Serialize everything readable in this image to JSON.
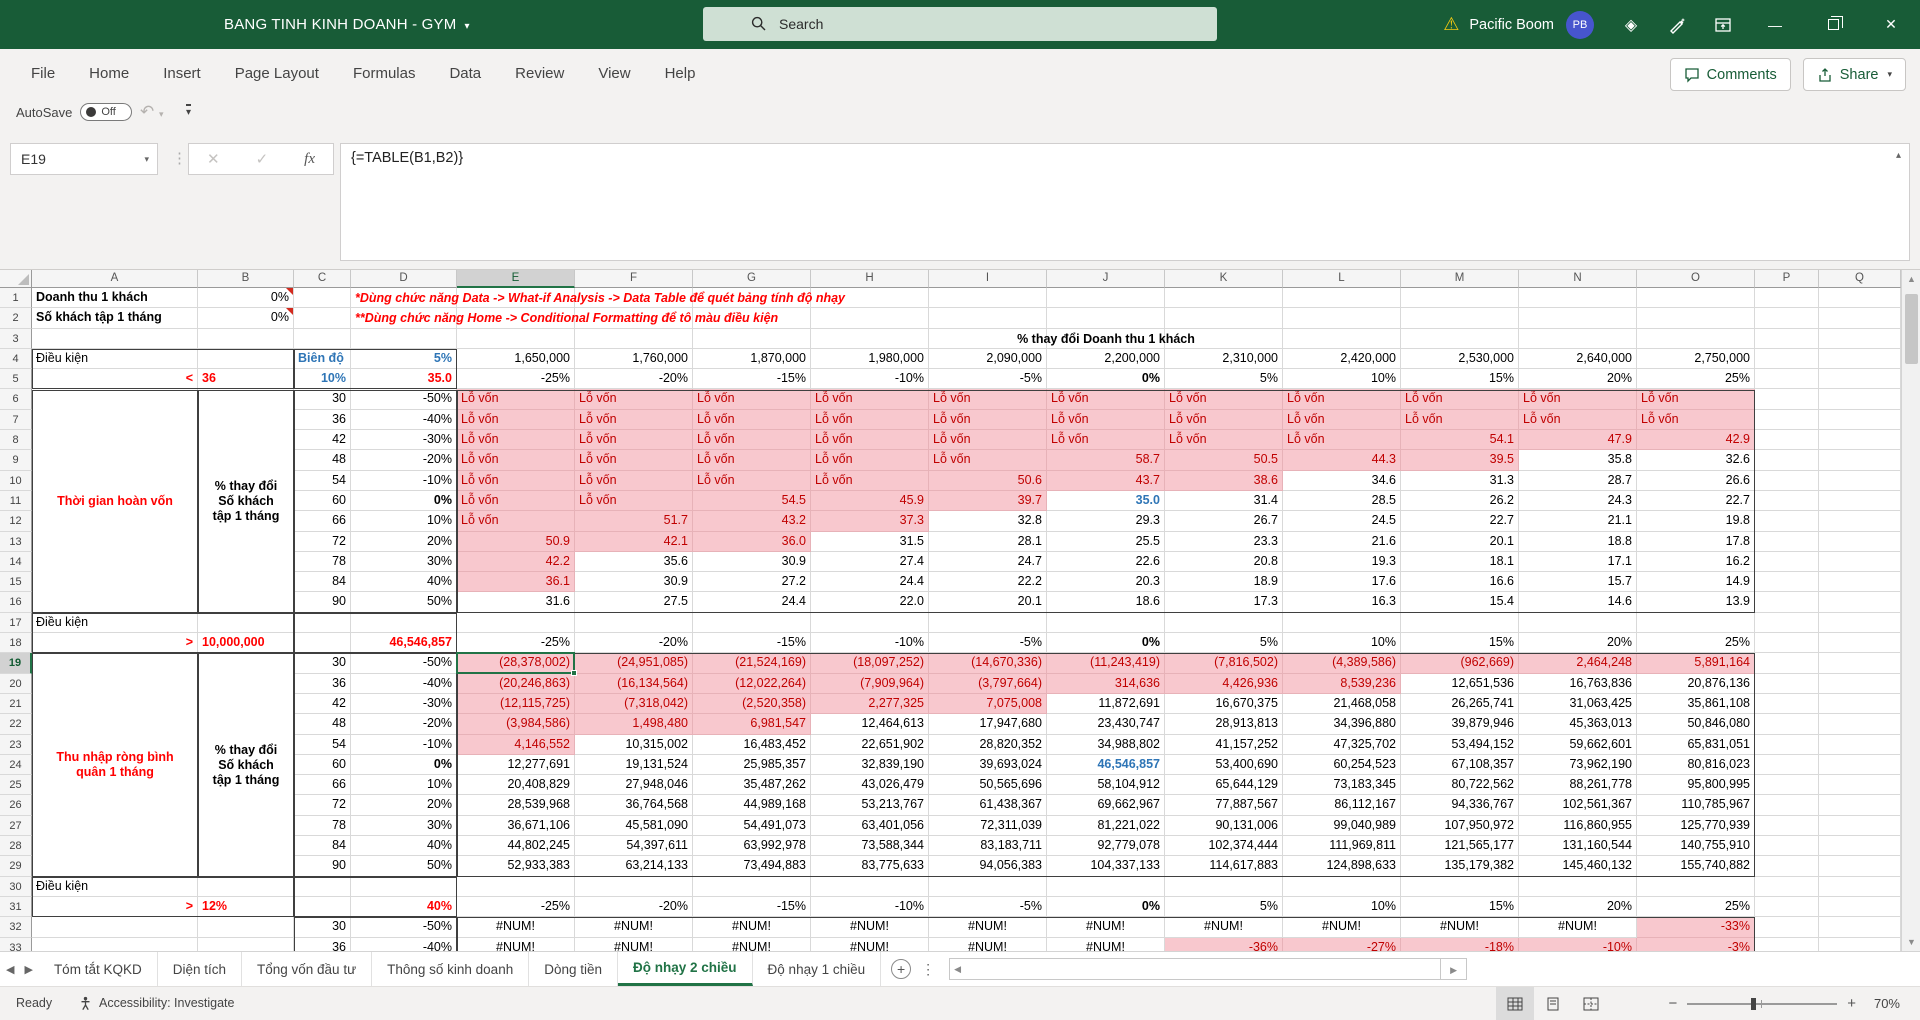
{
  "titlebar": {
    "doc_title": "BANG TINH KINH DOANH - GYM",
    "search_placeholder": "Search",
    "account_name": "Pacific Boom",
    "account_initials": "PB"
  },
  "menu": {
    "items": [
      "File",
      "Home",
      "Insert",
      "Page Layout",
      "Formulas",
      "Data",
      "Review",
      "View",
      "Help"
    ],
    "comments_label": "Comments",
    "share_label": "Share"
  },
  "qat": {
    "autosave_label": "AutoSave",
    "autosave_state": "Off"
  },
  "formula_bar": {
    "cell_ref": "E19",
    "formula": "{=TABLE(B1,B2)}"
  },
  "labels": {
    "lo_von": "Lỗ vốn",
    "num_err": "#NUM!"
  },
  "notes": {
    "note1": "*Dùng chức năng Data -> What-if Analysis -> Data Table để quét bảng tính độ nhạy",
    "note2": "**Dùng chức năng Home -> Conditional Formatting để tô màu điều kiện"
  },
  "grid": {
    "columns": [
      "A",
      "B",
      "C",
      "D",
      "E",
      "F",
      "G",
      "H",
      "I",
      "J",
      "K",
      "L",
      "M",
      "N",
      "O",
      "P",
      "Q"
    ],
    "revenue_header": "% thay đổi Doanh thu 1 khách",
    "money_cols": [
      "1,650,000",
      "1,760,000",
      "1,870,000",
      "1,980,000",
      "2,090,000",
      "2,200,000",
      "2,310,000",
      "2,420,000",
      "2,530,000",
      "2,640,000",
      "2,750,000"
    ],
    "pct_cols": [
      "-25%",
      "-20%",
      "-15%",
      "-10%",
      "-5%",
      "0%",
      "5%",
      "10%",
      "15%",
      "20%",
      "25%"
    ],
    "selection": {
      "ref": "E19",
      "col": "E",
      "row": 19
    },
    "cells_static": [
      {
        "r": 1,
        "c": "A",
        "t": "Doanh thu 1 khách",
        "cls": "b lft"
      },
      {
        "r": 1,
        "c": "B",
        "t": "0%",
        "cls": "rt cmt"
      },
      {
        "r": 2,
        "c": "A",
        "t": "Số khách tập 1 tháng",
        "cls": "b lft"
      },
      {
        "r": 2,
        "c": "B",
        "t": "0%",
        "cls": "rt cmt"
      },
      {
        "r": 4,
        "c": "A",
        "t": "Điều kiện",
        "cls": "lft"
      },
      {
        "r": 4,
        "c": "C",
        "t": "Biên độ",
        "cls": "blue lft"
      },
      {
        "r": 4,
        "c": "D",
        "t": "5%",
        "cls": "blue rt"
      },
      {
        "r": 5,
        "c": "A",
        "t": "<",
        "cls": "red2 b rt"
      },
      {
        "r": 5,
        "c": "B",
        "t": "36",
        "cls": "red2 b lft"
      },
      {
        "r": 5,
        "c": "C",
        "t": "10%",
        "cls": "blue rt"
      },
      {
        "r": 5,
        "c": "D",
        "t": "35.0",
        "cls": "red2 b rt"
      },
      {
        "r": 17,
        "c": "A",
        "t": "Điều kiện",
        "cls": "lft"
      },
      {
        "r": 18,
        "c": "A",
        "t": ">",
        "cls": "red2 b rt"
      },
      {
        "r": 18,
        "c": "B",
        "t": "10,000,000",
        "cls": "red2 b lft"
      },
      {
        "r": 18,
        "c": "D",
        "t": "46,546,857",
        "cls": "red2 b rt"
      },
      {
        "r": 30,
        "c": "A",
        "t": "Điều kiện",
        "cls": "lft"
      },
      {
        "r": 31,
        "c": "A",
        "t": ">",
        "cls": "red2 b rt"
      },
      {
        "r": 31,
        "c": "B",
        "t": "12%",
        "cls": "red2 b lft"
      },
      {
        "r": 31,
        "c": "D",
        "t": "40%",
        "cls": "red2 b rt"
      }
    ]
  },
  "table1": {
    "a_label_lines": [
      "Thời gian hoàn vốn"
    ],
    "b_label_lines": [
      "% thay đổi",
      "Số khách",
      "tập 1 tháng"
    ],
    "rows": [
      {
        "r": 6,
        "khach": "30",
        "pct": "-50%",
        "cells": [
          "L",
          "L",
          "L",
          "L",
          "L",
          "L",
          "L",
          "L",
          "L",
          "L",
          "L"
        ]
      },
      {
        "r": 7,
        "khach": "36",
        "pct": "-40%",
        "cells": [
          "L",
          "L",
          "L",
          "L",
          "L",
          "L",
          "L",
          "L",
          "L",
          "L",
          "L"
        ]
      },
      {
        "r": 8,
        "khach": "42",
        "pct": "-30%",
        "cells": [
          "L",
          "L",
          "L",
          "L",
          "L",
          "L",
          "L",
          "L",
          "p:54.1",
          "p:47.9",
          "p:42.9"
        ]
      },
      {
        "r": 9,
        "khach": "48",
        "pct": "-20%",
        "cells": [
          "L",
          "L",
          "L",
          "L",
          "L",
          "p:58.7",
          "p:50.5",
          "p:44.3",
          "p:39.5",
          "w:35.8",
          "w:32.6"
        ]
      },
      {
        "r": 10,
        "khach": "54",
        "pct": "-10%",
        "cells": [
          "L",
          "L",
          "L",
          "L",
          "p:50.6",
          "p:43.7",
          "p:38.6",
          "w:34.6",
          "w:31.3",
          "w:28.7",
          "w:26.6"
        ]
      },
      {
        "r": 11,
        "khach": "60",
        "pct": "0%",
        "cells": [
          "L",
          "L",
          "p:54.5",
          "p:45.9",
          "p:39.7",
          "b:35.0",
          "w:31.4",
          "w:28.5",
          "w:26.2",
          "w:24.3",
          "w:22.7"
        ]
      },
      {
        "r": 12,
        "khach": "66",
        "pct": "10%",
        "cells": [
          "L",
          "p:51.7",
          "p:43.2",
          "p:37.3",
          "w:32.8",
          "w:29.3",
          "w:26.7",
          "w:24.5",
          "w:22.7",
          "w:21.1",
          "w:19.8"
        ]
      },
      {
        "r": 13,
        "khach": "72",
        "pct": "20%",
        "cells": [
          "p:50.9",
          "p:42.1",
          "p:36.0",
          "w:31.5",
          "w:28.1",
          "w:25.5",
          "w:23.3",
          "w:21.6",
          "w:20.1",
          "w:18.8",
          "w:17.8"
        ]
      },
      {
        "r": 14,
        "khach": "78",
        "pct": "30%",
        "cells": [
          "p:42.2",
          "w:35.6",
          "w:30.9",
          "w:27.4",
          "w:24.7",
          "w:22.6",
          "w:20.8",
          "w:19.3",
          "w:18.1",
          "w:17.1",
          "w:16.2"
        ]
      },
      {
        "r": 15,
        "khach": "84",
        "pct": "40%",
        "cells": [
          "p:36.1",
          "w:30.9",
          "w:27.2",
          "w:24.4",
          "w:22.2",
          "w:20.3",
          "w:18.9",
          "w:17.6",
          "w:16.6",
          "w:15.7",
          "w:14.9"
        ]
      },
      {
        "r": 16,
        "khach": "90",
        "pct": "50%",
        "cells": [
          "w:31.6",
          "w:27.5",
          "w:24.4",
          "w:22.0",
          "w:20.1",
          "w:18.6",
          "w:17.3",
          "w:16.3",
          "w:15.4",
          "w:14.6",
          "w:13.9"
        ]
      }
    ]
  },
  "table2": {
    "a_label_lines": [
      "Thu nhập ròng bình",
      "quân 1 tháng"
    ],
    "b_label_lines": [
      "% thay đổi",
      "Số khách",
      "tập 1 tháng"
    ],
    "rows": [
      {
        "r": 19,
        "khach": "30",
        "pct": "-50%",
        "cells": [
          "p:(28,378,002)",
          "p:(24,951,085)",
          "p:(21,524,169)",
          "p:(18,097,252)",
          "p:(14,670,336)",
          "p:(11,243,419)",
          "p:(7,816,502)",
          "p:(4,389,586)",
          "p:(962,669)",
          "p:2,464,248",
          "p:5,891,164"
        ]
      },
      {
        "r": 20,
        "khach": "36",
        "pct": "-40%",
        "cells": [
          "p:(20,246,863)",
          "p:(16,134,564)",
          "p:(12,022,264)",
          "p:(7,909,964)",
          "p:(3,797,664)",
          "p:314,636",
          "p:4,426,936",
          "p:8,539,236",
          "w:12,651,536",
          "w:16,763,836",
          "w:20,876,136"
        ]
      },
      {
        "r": 21,
        "khach": "42",
        "pct": "-30%",
        "cells": [
          "p:(12,115,725)",
          "p:(7,318,042)",
          "p:(2,520,358)",
          "p:2,277,325",
          "p:7,075,008",
          "w:11,872,691",
          "w:16,670,375",
          "w:21,468,058",
          "w:26,265,741",
          "w:31,063,425",
          "w:35,861,108"
        ]
      },
      {
        "r": 22,
        "khach": "48",
        "pct": "-20%",
        "cells": [
          "p:(3,984,586)",
          "p:1,498,480",
          "p:6,981,547",
          "w:12,464,613",
          "w:17,947,680",
          "w:23,430,747",
          "w:28,913,813",
          "w:34,396,880",
          "w:39,879,946",
          "w:45,363,013",
          "w:50,846,080"
        ]
      },
      {
        "r": 23,
        "khach": "54",
        "pct": "-10%",
        "cells": [
          "p:4,146,552",
          "w:10,315,002",
          "w:16,483,452",
          "w:22,651,902",
          "w:28,820,352",
          "w:34,988,802",
          "w:41,157,252",
          "w:47,325,702",
          "w:53,494,152",
          "w:59,662,601",
          "w:65,831,051"
        ]
      },
      {
        "r": 24,
        "khach": "60",
        "pct": "0%",
        "cells": [
          "w:12,277,691",
          "w:19,131,524",
          "w:25,985,357",
          "w:32,839,190",
          "w:39,693,024",
          "b:46,546,857",
          "w:53,400,690",
          "w:60,254,523",
          "w:67,108,357",
          "w:73,962,190",
          "w:80,816,023"
        ]
      },
      {
        "r": 25,
        "khach": "66",
        "pct": "10%",
        "cells": [
          "w:20,408,829",
          "w:27,948,046",
          "w:35,487,262",
          "w:43,026,479",
          "w:50,565,696",
          "w:58,104,912",
          "w:65,644,129",
          "w:73,183,345",
          "w:80,722,562",
          "w:88,261,778",
          "w:95,800,995"
        ]
      },
      {
        "r": 26,
        "khach": "72",
        "pct": "20%",
        "cells": [
          "w:28,539,968",
          "w:36,764,568",
          "w:44,989,168",
          "w:53,213,767",
          "w:61,438,367",
          "w:69,662,967",
          "w:77,887,567",
          "w:86,112,167",
          "w:94,336,767",
          "w:102,561,367",
          "w:110,785,967"
        ]
      },
      {
        "r": 27,
        "khach": "78",
        "pct": "30%",
        "cells": [
          "w:36,671,106",
          "w:45,581,090",
          "w:54,491,073",
          "w:63,401,056",
          "w:72,311,039",
          "w:81,221,022",
          "w:90,131,006",
          "w:99,040,989",
          "w:107,950,972",
          "w:116,860,955",
          "w:125,770,939"
        ]
      },
      {
        "r": 28,
        "khach": "84",
        "pct": "40%",
        "cells": [
          "w:44,802,245",
          "w:54,397,611",
          "w:63,992,978",
          "w:73,588,344",
          "w:83,183,711",
          "w:92,779,078",
          "w:102,374,444",
          "w:111,969,811",
          "w:121,565,177",
          "w:131,160,544",
          "w:140,755,910"
        ]
      },
      {
        "r": 29,
        "khach": "90",
        "pct": "50%",
        "cells": [
          "w:52,933,383",
          "w:63,214,133",
          "w:73,494,883",
          "w:83,775,633",
          "w:94,056,383",
          "w:104,337,133",
          "w:114,617,883",
          "w:124,898,633",
          "w:135,179,382",
          "w:145,460,132",
          "w:155,740,882"
        ]
      }
    ]
  },
  "table3": {
    "rows": [
      {
        "r": 32,
        "khach": "30",
        "pct": "-50%",
        "cells": [
          "e",
          "e",
          "e",
          "e",
          "e",
          "e",
          "e",
          "e",
          "e",
          "e",
          "p:-33%"
        ]
      },
      {
        "r": 33,
        "khach": "36",
        "pct": "-40%",
        "cells": [
          "e",
          "e",
          "e",
          "e",
          "e",
          "e",
          "p:-36%",
          "p:-27%",
          "p:-18%",
          "p:-10%",
          "p:-3%"
        ]
      }
    ]
  },
  "sheet_tabs": {
    "tabs": [
      "Tóm tắt KQKD",
      "Diện tích",
      "Tổng vốn đầu tư",
      "Thông số kinh doanh",
      "Dòng tiền",
      "Độ nhạy 2 chiều",
      "Độ nhạy 1 chiều"
    ],
    "active_index": 5
  },
  "status_bar": {
    "ready": "Ready",
    "accessibility": "Accessibility: Investigate",
    "zoom_pct": "70%"
  },
  "colors": {
    "accent_green": "#217346",
    "titlebar_green": "#185C37",
    "pink_fill": "#F8C8CE",
    "red_value": "#C00000",
    "red_label": "#FF0000",
    "blue_value": "#2E75B6"
  }
}
